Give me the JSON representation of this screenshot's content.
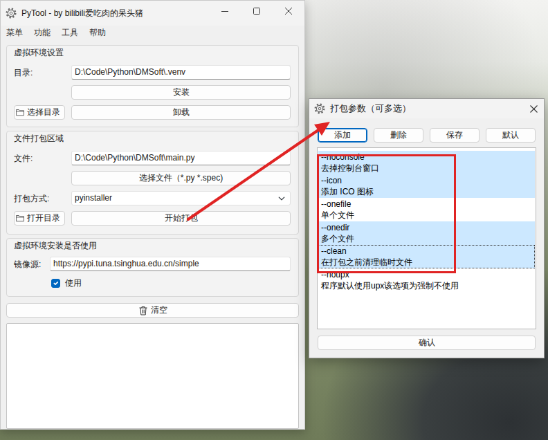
{
  "main_window": {
    "title": "PyTool - by bilibili爱吃肉的呆头猪",
    "menu": [
      "菜单",
      "功能",
      "工具",
      "帮助"
    ]
  },
  "venv": {
    "title": "虚拟环境设置",
    "dir_label": "目录:",
    "dir_value": "D:\\Code\\Python\\DMSoft\\.venv",
    "install": "安装",
    "choose_dir": "选择目录",
    "uninstall": "卸载"
  },
  "pack": {
    "title": "文件打包区域",
    "file_label": "文件:",
    "file_value": "D:\\Code\\Python\\DMSoft\\main.py",
    "choose_file": "选择文件（*.py *.spec)",
    "method_label": "打包方式:",
    "method_value": "pyinstaller",
    "open_dir": "打开目录",
    "start": "开始打包"
  },
  "mirror": {
    "title": "虚拟环境安装是否使用",
    "label": "镜像源:",
    "value": "https://pypi.tuna.tsinghua.edu.cn/simple",
    "use_label": "使用",
    "use_checked": true
  },
  "clear_button": "清空",
  "dialog": {
    "title": "打包参数（可多选）",
    "buttons": [
      {
        "label": "添加",
        "focused": true
      },
      {
        "label": "删除",
        "focused": false
      },
      {
        "label": "保存",
        "focused": false
      },
      {
        "label": "默认",
        "focused": false
      }
    ],
    "options": [
      {
        "flag": "--noconsole",
        "desc": "去掉控制台窗口",
        "selected": true,
        "focused": false
      },
      {
        "flag": "--icon",
        "desc": "添加 ICO 图标",
        "selected": true,
        "focused": false
      },
      {
        "flag": "--onefile",
        "desc": "单个文件",
        "selected": false,
        "focused": false
      },
      {
        "flag": "--onedir",
        "desc": "多个文件",
        "selected": true,
        "focused": false
      },
      {
        "flag": "--clean",
        "desc": "在打包之前清理临时文件",
        "selected": true,
        "focused": true
      },
      {
        "flag": "--noupx",
        "desc": "程序默认使用upx该选项为强制不使用",
        "selected": false,
        "focused": false
      }
    ],
    "confirm": "确认"
  }
}
